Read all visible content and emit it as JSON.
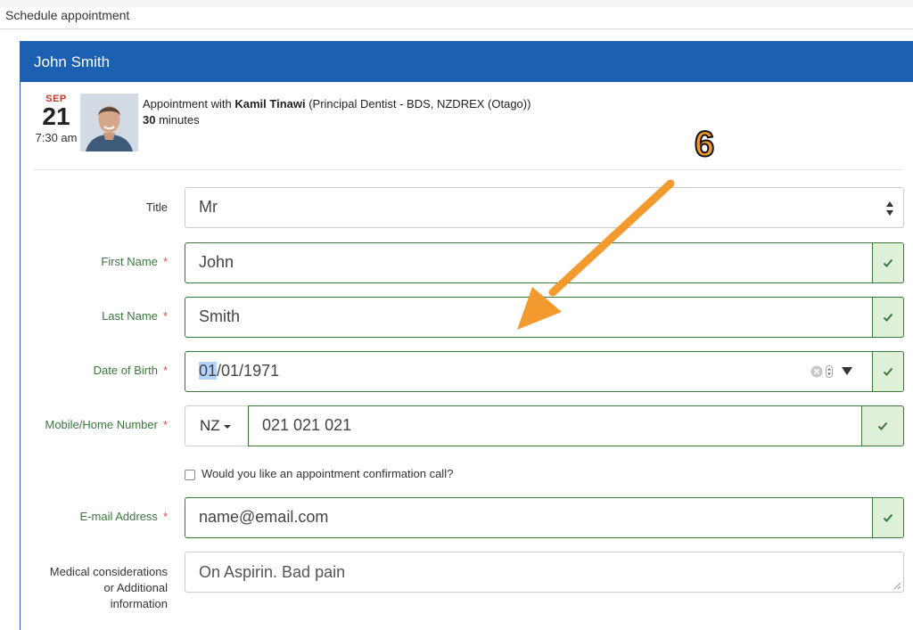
{
  "topbar": {
    "title": "Schedule appointment"
  },
  "panel": {
    "title": "John Smith"
  },
  "date": {
    "month": "SEP",
    "day": "21",
    "time": "7:30 am"
  },
  "appointment": {
    "prefix": "Appointment with",
    "dentist": "Kamil Tinawi",
    "role": "(Principal Dentist - BDS, NZDREX (Otago))",
    "duration_value": "30",
    "duration_unit": "minutes"
  },
  "form": {
    "title": {
      "label": "Title",
      "value": "Mr"
    },
    "first_name": {
      "label": "First Name",
      "value": "John"
    },
    "last_name": {
      "label": "Last Name",
      "value": "Smith"
    },
    "dob": {
      "label": "Date of Birth",
      "day": "01",
      "rest": "/01/1971"
    },
    "mobile": {
      "label": "Mobile/Home Number",
      "country": "NZ",
      "value": "021 021 021"
    },
    "confirmation_call": {
      "label": "Would you like an appointment confirmation call?"
    },
    "email": {
      "label": "E-mail Address",
      "value": "name@email.com"
    },
    "medical": {
      "label_1": "Medical considerations",
      "label_2": "or Additional",
      "label_3": "information",
      "value": "On Aspirin. Bad pain"
    }
  },
  "required_marker": "*",
  "annotation": {
    "number": "6",
    "color": "#f29a2e"
  },
  "colors": {
    "header": "#1c60b2",
    "success": "#3c763d",
    "success_bg": "#dff0d8"
  },
  "icons": [
    "check-icon",
    "clear-icon",
    "spinner-icon",
    "dropdown-triangle-icon",
    "select-arrows-icon",
    "caret-down-icon",
    "resize-handle-icon",
    "annotation-arrow-icon"
  ]
}
